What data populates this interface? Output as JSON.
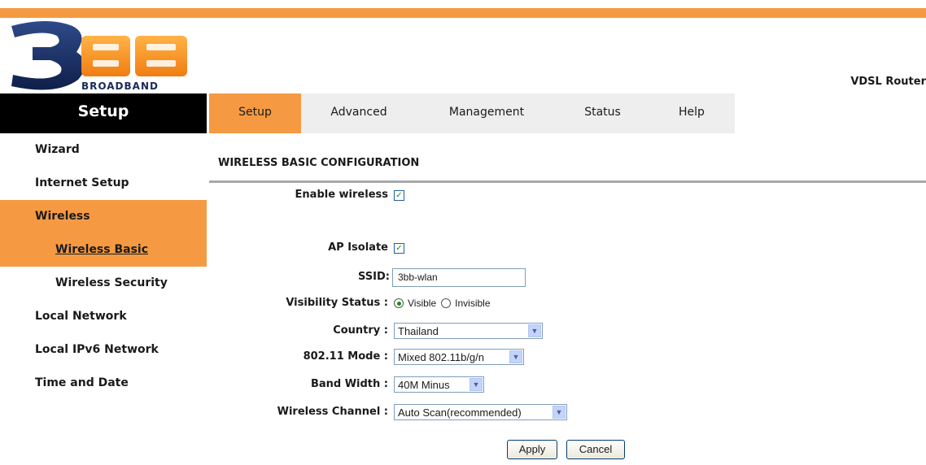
{
  "brand": {
    "logo_digit": "3",
    "logo_letters": "BB",
    "logo_text": "BROADBAND",
    "product": "VDSL Router"
  },
  "colors": {
    "accent": "#f59a42",
    "sidebar_header": "#000000"
  },
  "sidebar": {
    "title": "Setup",
    "items": [
      {
        "label": "Wizard",
        "active": false,
        "sub": false
      },
      {
        "label": "Internet Setup",
        "active": false,
        "sub": false
      },
      {
        "label": "Wireless",
        "active": true,
        "sub": false
      },
      {
        "label": "Wireless Basic",
        "active": true,
        "sub": true
      },
      {
        "label": "Wireless Security",
        "active": false,
        "sub": true
      },
      {
        "label": "Local Network",
        "active": false,
        "sub": false
      },
      {
        "label": "Local IPv6 Network",
        "active": false,
        "sub": false
      },
      {
        "label": "Time and Date",
        "active": false,
        "sub": false
      }
    ]
  },
  "tabs": [
    {
      "label": "Setup",
      "active": true
    },
    {
      "label": "Advanced",
      "active": false
    },
    {
      "label": "Management",
      "active": false
    },
    {
      "label": "Status",
      "active": false
    },
    {
      "label": "Help",
      "active": false
    }
  ],
  "page": {
    "title": "WIRELESS BASIC CONFIGURATION",
    "enable_wireless": {
      "label": "Enable wireless",
      "checked": true
    },
    "ap_isolate": {
      "label": "AP Isolate",
      "checked": true
    },
    "ssid": {
      "label": "SSID:",
      "value": "3bb-wlan"
    },
    "visibility": {
      "label": "Visibility Status :",
      "options": [
        "Visible",
        "Invisible"
      ],
      "selected": "Visible"
    },
    "country": {
      "label": "Country :",
      "value": "Thailand"
    },
    "mode": {
      "label": "802.11 Mode :",
      "value": "Mixed 802.11b/g/n"
    },
    "bandwidth": {
      "label": "Band Width :",
      "value": "40M Minus"
    },
    "channel": {
      "label": "Wireless Channel :",
      "value": "Auto Scan(recommended)"
    },
    "apply_label": "Apply",
    "cancel_label": "Cancel"
  }
}
